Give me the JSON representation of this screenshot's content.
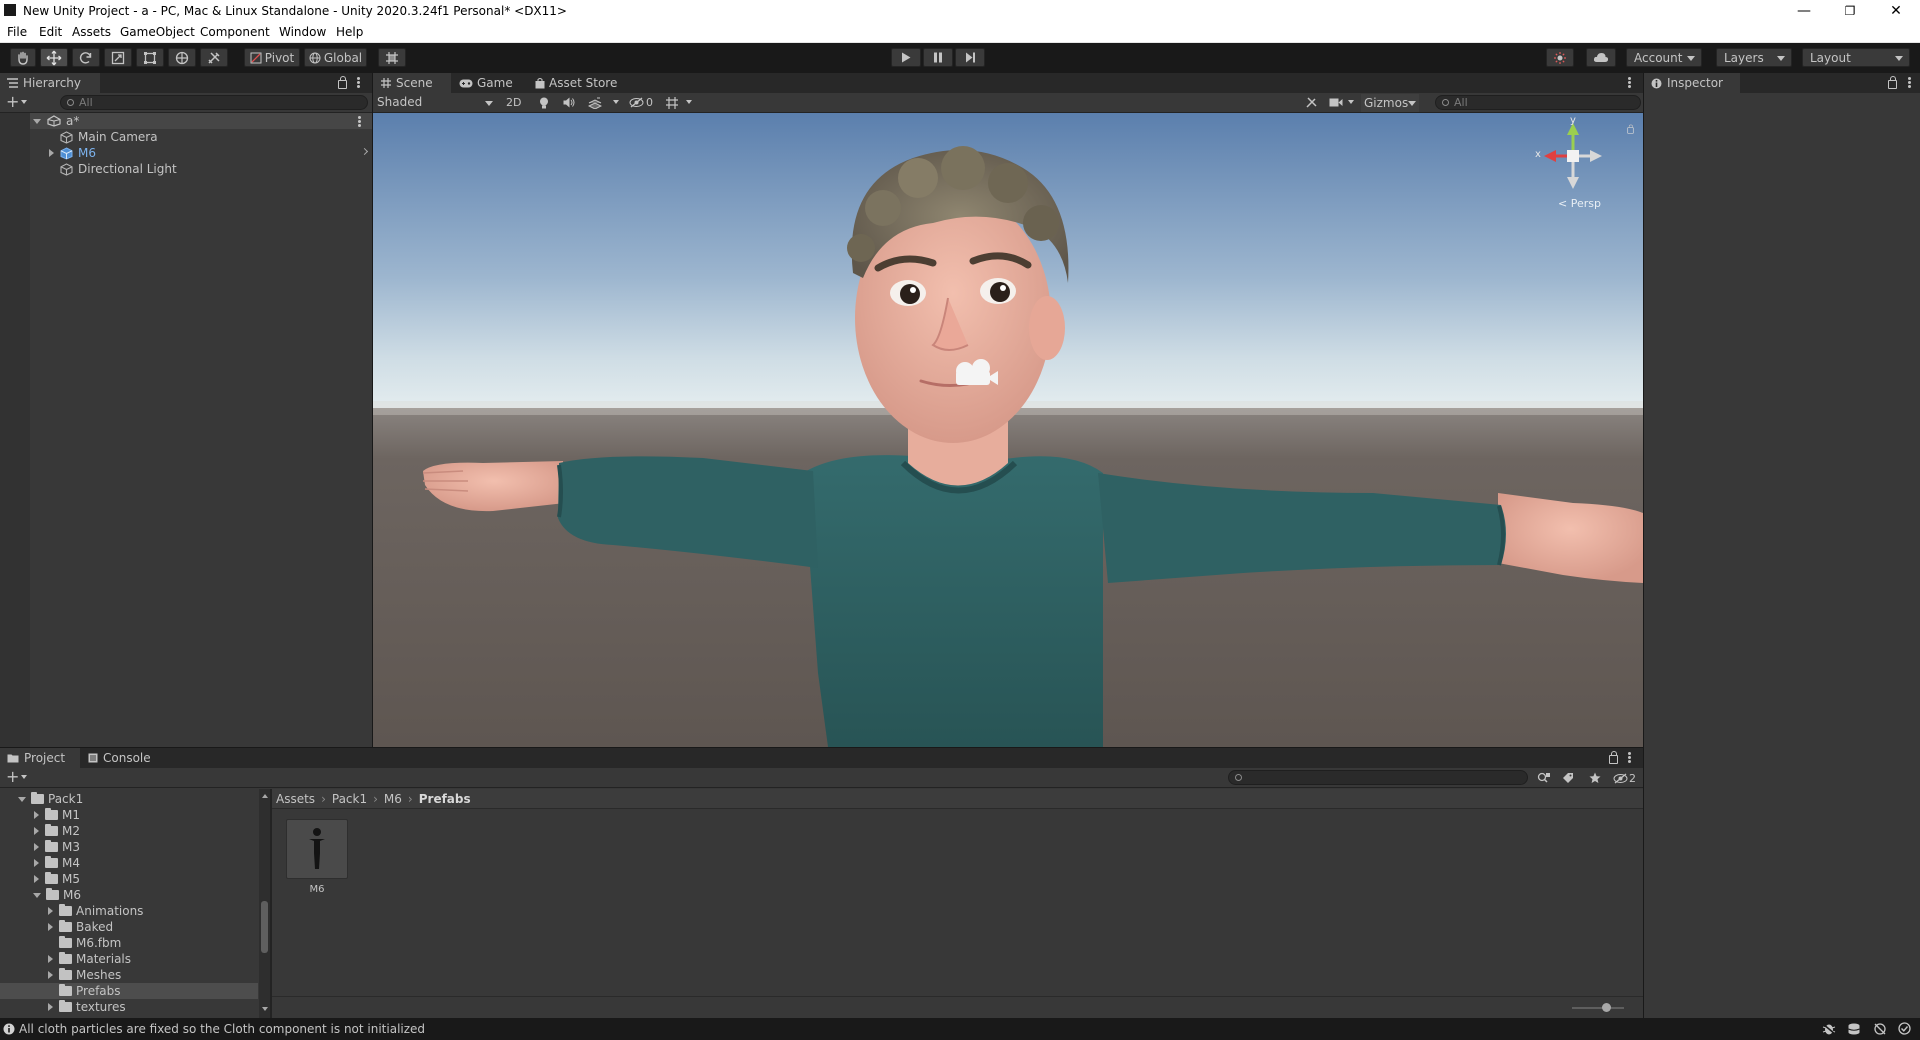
{
  "window": {
    "title": "New Unity Project - a - PC, Mac & Linux Standalone - Unity 2020.3.24f1 Personal* <DX11>",
    "minimize": "—",
    "maximize": "❐",
    "close": "✕"
  },
  "menu": [
    "File",
    "Edit",
    "Assets",
    "GameObject",
    "Component",
    "Window",
    "Help"
  ],
  "toolbar": {
    "pivot": "Pivot",
    "global": "Global",
    "account": "Account",
    "layers": "Layers",
    "layout": "Layout"
  },
  "hierarchy": {
    "tab": "Hierarchy",
    "search_placeholder": "All",
    "scene": "a*",
    "items": [
      {
        "label": "Main Camera"
      },
      {
        "label": "M6"
      },
      {
        "label": "Directional Light"
      }
    ]
  },
  "scene_view": {
    "tabs": [
      "Scene",
      "Game",
      "Asset Store"
    ],
    "shading_mode": "Shaded",
    "mode_2d": "2D",
    "hidden_count": "0",
    "gizmos": "Gizmos",
    "search_placeholder": "All",
    "projection": "Persp",
    "axis_x": "x",
    "axis_y": "y"
  },
  "inspector": {
    "tab": "Inspector"
  },
  "project": {
    "tabs": [
      "Project",
      "Console"
    ],
    "hidden_count": "2",
    "breadcrumb": [
      "Assets",
      "Pack1",
      "M6",
      "Prefabs"
    ],
    "tree": [
      {
        "label": "Pack1"
      },
      {
        "label": "M1"
      },
      {
        "label": "M2"
      },
      {
        "label": "M3"
      },
      {
        "label": "M4"
      },
      {
        "label": "M5"
      },
      {
        "label": "M6"
      },
      {
        "label": "Animations"
      },
      {
        "label": "Baked"
      },
      {
        "label": "M6.fbm"
      },
      {
        "label": "Materials"
      },
      {
        "label": "Meshes"
      },
      {
        "label": "Prefabs"
      },
      {
        "label": "textures"
      }
    ],
    "assets": [
      {
        "label": "M6"
      }
    ]
  },
  "status": {
    "message": "All cloth particles are fixed so the Cloth component is not initialized"
  },
  "colors": {
    "background": "#191919",
    "panel": "#383838",
    "selection": "#2c5d87",
    "prefab_blue": "#7bb1ec",
    "sky_top": "#5b7fad",
    "ground": "#6e6660",
    "shirt": "#2f6163"
  }
}
